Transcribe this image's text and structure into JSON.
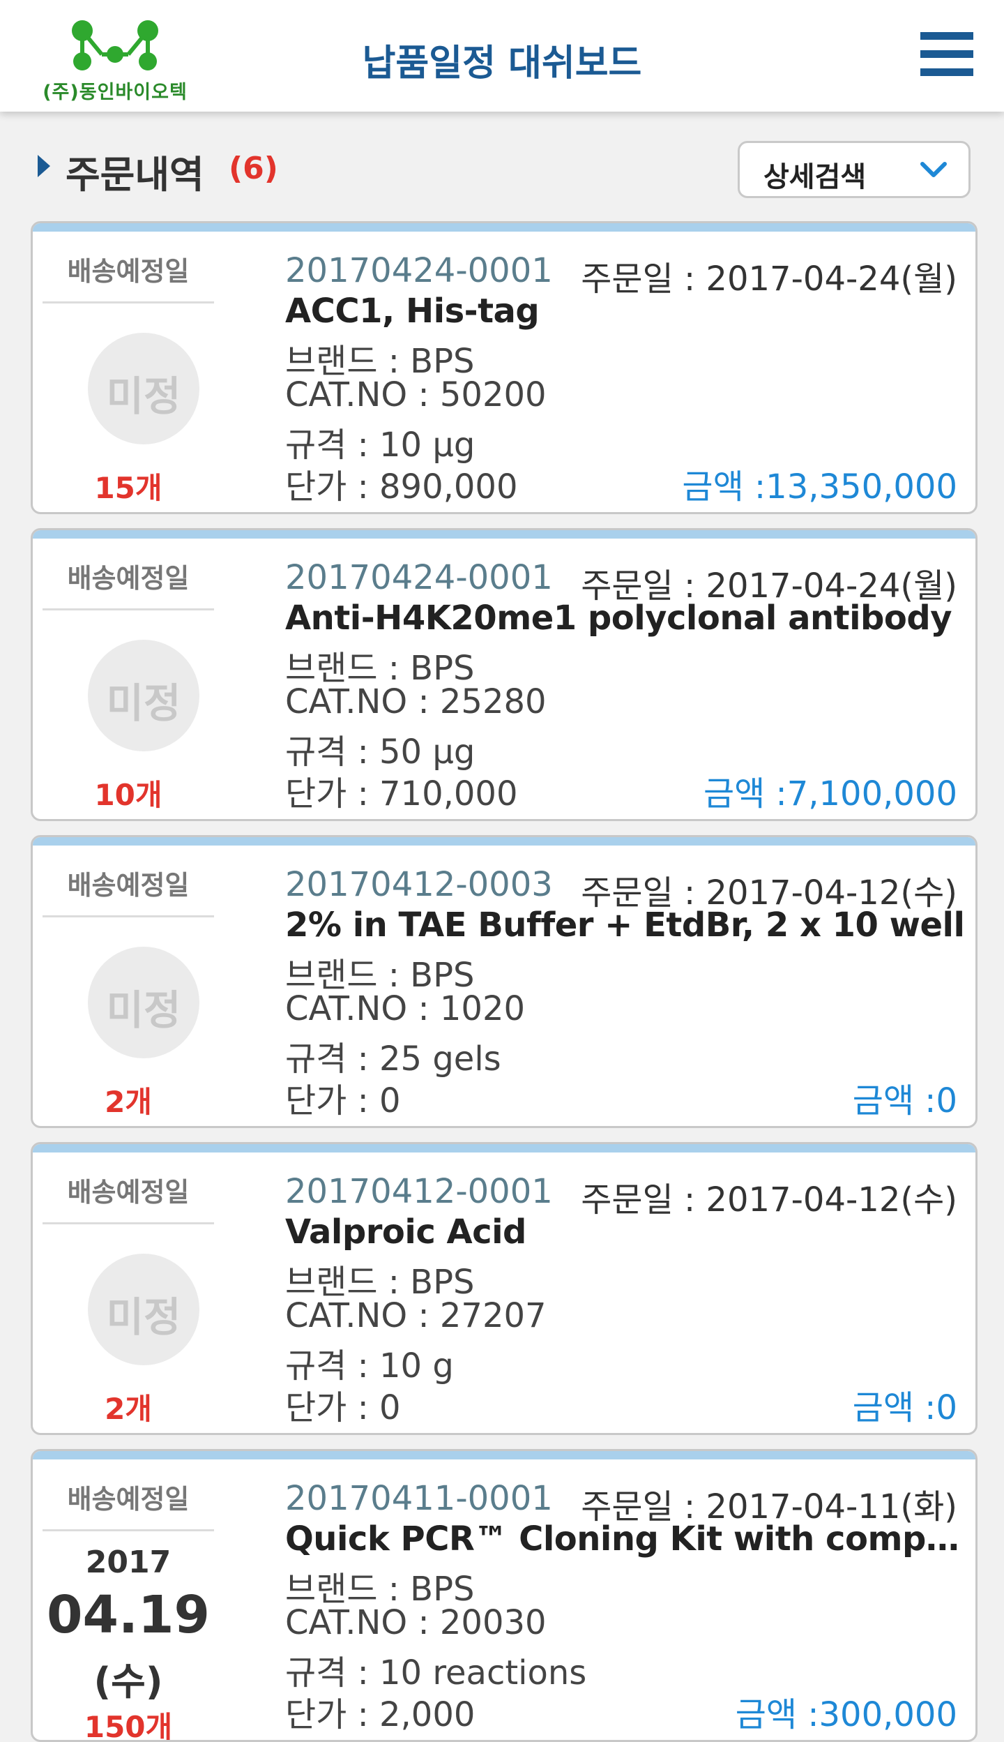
{
  "header": {
    "logo_text": "(주)동인바이오텍",
    "title": "납품일정 대쉬보드",
    "menu_icon": "hamburger-menu-icon"
  },
  "section": {
    "title": "주문내역",
    "count": "(6)",
    "search_button_label": "상세검색",
    "search_icon": "chevron-down-icon"
  },
  "colors": {
    "brand_blue": "#1b5a93",
    "accent_red": "#e2342c",
    "amount_blue": "#1e88d6",
    "card_top": "#a9d0ec",
    "logo_green": "#2a8a2a"
  },
  "orders": [
    {
      "ship_label": "배송예정일",
      "ship_status": "미정",
      "quantity": "15개",
      "order_no": "20170424-0001",
      "order_date": "주문일 : 2017-04-24(월)",
      "product": "ACC1, His-tag",
      "brand": "브랜드 : BPS",
      "cat_no": "CAT.NO : 50200",
      "spec": "규격 : 10 μg",
      "unit_price": "단가 : 890,000",
      "amount": "금액 :13,350,000"
    },
    {
      "ship_label": "배송예정일",
      "ship_status": "미정",
      "quantity": "10개",
      "order_no": "20170424-0001",
      "order_date": "주문일 : 2017-04-24(월)",
      "product": "Anti-H4K20me1 polyclonal antibody",
      "brand": "브랜드 : BPS",
      "cat_no": "CAT.NO : 25280",
      "spec": "규격 : 50 μg",
      "unit_price": "단가 : 710,000",
      "amount": "금액 :7,100,000"
    },
    {
      "ship_label": "배송예정일",
      "ship_status": "미정",
      "quantity": "2개",
      "order_no": "20170412-0003",
      "order_date": "주문일 : 2017-04-12(수)",
      "product": "2% in TAE Buffer + EtdBr, 2 x 10 well",
      "brand": "브랜드 : BPS",
      "cat_no": "CAT.NO : 1020",
      "spec": "규격 : 25 gels",
      "unit_price": "단가 : 0",
      "amount": "금액 :0"
    },
    {
      "ship_label": "배송예정일",
      "ship_status": "미정",
      "quantity": "2개",
      "order_no": "20170412-0001",
      "order_date": "주문일 : 2017-04-12(수)",
      "product": "Valproic Acid",
      "brand": "브랜드 : BPS",
      "cat_no": "CAT.NO : 27207",
      "spec": "규격 : 10 g",
      "unit_price": "단가 : 0",
      "amount": "금액 :0"
    },
    {
      "ship_label": "배송예정일",
      "ship_year": "2017",
      "ship_md": "04.19",
      "ship_dow": "(수)",
      "quantity": "150개",
      "order_no": "20170411-0001",
      "order_date": "주문일 : 2017-04-11(화)",
      "product": "Quick PCR™ Cloning Kit with competent…",
      "brand": "브랜드 : BPS",
      "cat_no": "CAT.NO : 20030",
      "spec": "규격 : 10 reactions",
      "unit_price": "단가 : 2,000",
      "amount": "금액 :300,000"
    }
  ]
}
